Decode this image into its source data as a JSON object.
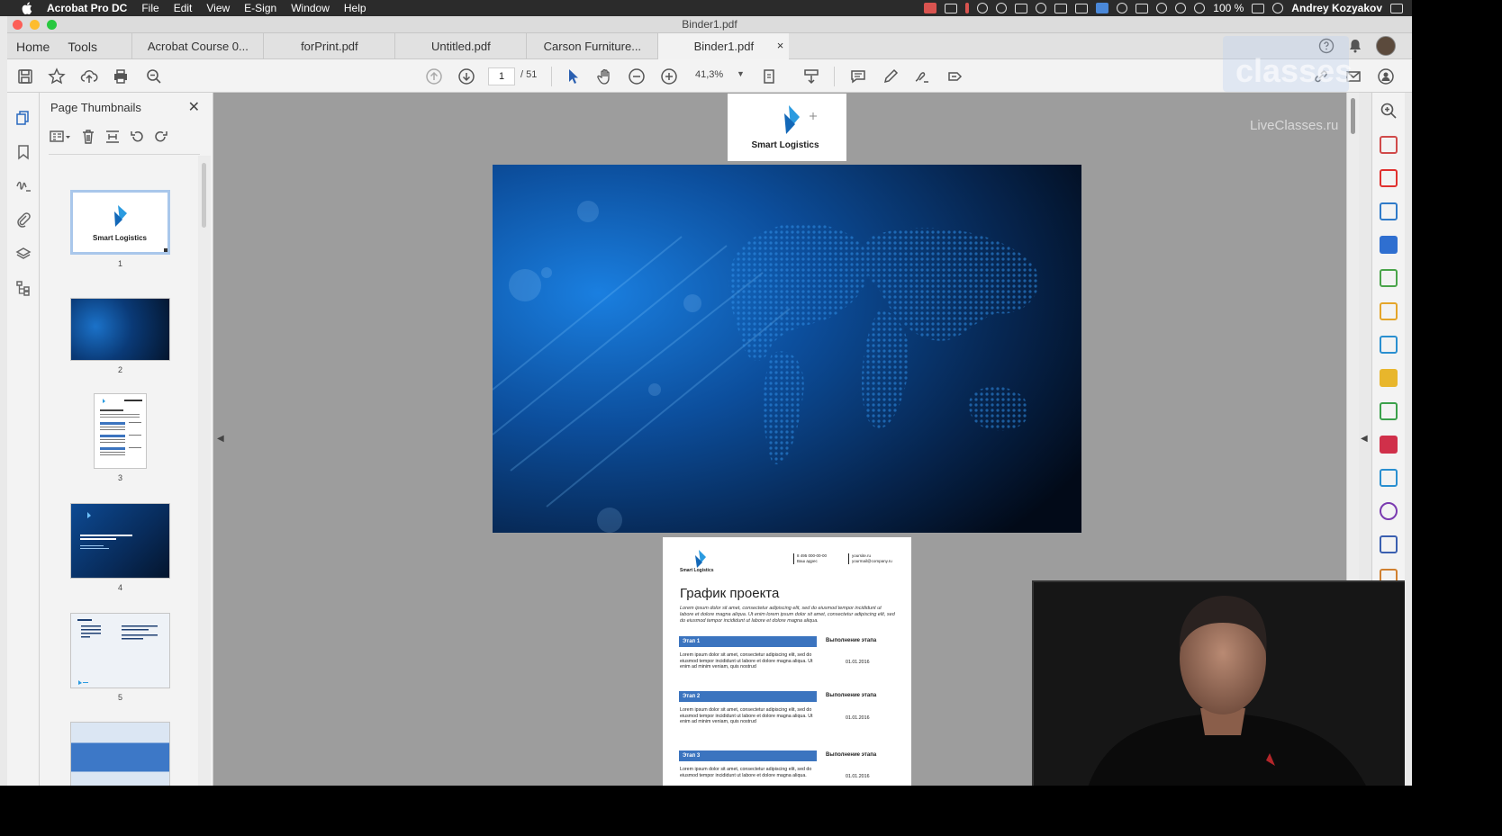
{
  "menubar": {
    "app_name": "Acrobat Pro DC",
    "items": [
      "File",
      "Edit",
      "View",
      "E-Sign",
      "Window",
      "Help"
    ],
    "battery": "100 %",
    "user": "Andrey Kozyakov"
  },
  "window": {
    "title": "Binder1.pdf"
  },
  "tabs": {
    "home": "Home",
    "tools": "Tools",
    "documents": [
      {
        "label": "Acrobat Course 0..."
      },
      {
        "label": "forPrint.pdf"
      },
      {
        "label": "Untitled.pdf"
      },
      {
        "label": "Carson Furniture..."
      },
      {
        "label": "Binder1.pdf",
        "active": true
      }
    ],
    "close_glyph": "×"
  },
  "toolbar": {
    "current_page": "1",
    "total_pages": "/ 51",
    "zoom": "41,3%"
  },
  "thumbnails_panel": {
    "title": "Page Thumbnails",
    "close_glyph": "✕",
    "pages": [
      {
        "number": "1",
        "kind": "logo",
        "selected": true
      },
      {
        "number": "2",
        "kind": "blue"
      },
      {
        "number": "3",
        "kind": "text"
      },
      {
        "number": "4",
        "kind": "blue-title"
      },
      {
        "number": "5",
        "kind": "agenda"
      },
      {
        "number": "",
        "kind": "office"
      }
    ]
  },
  "document": {
    "page1": {
      "logo_text": "Smart Logistics"
    },
    "page3": {
      "logo_text": "Smart Logistics",
      "contacts": [
        {
          "line1": "8 495 000-00-00",
          "line2": "Ваш адрес"
        },
        {
          "line1": "yoursite.ru",
          "line2": "yourmail@company.ru"
        }
      ],
      "title": "График проекта",
      "intro": "Lorem ipsum dolor sit amet, consectetur adipiscing elit, sed do eiusmod tempor incididunt ut labore et dolore magna aliqua. Ut enim lorem ipsum dolor sit amet, consectetur adipiscing elit, sed do eiusmod tempor incididunt ut labore et dolore magna aliqua.",
      "stages": [
        {
          "name": "Этап 1",
          "header": "Выполнение этапа",
          "text": "Lorem ipsum dolor sit amet, consectetur adipiscing elit, sed do eiusmod tempor incididunt ut labore et dolore magna aliqua. Ut enim ad minim veniam, quis nostrud",
          "date": "01.01.2016"
        },
        {
          "name": "Этап 2",
          "header": "Выполнение этапа",
          "text": "Lorem ipsum dolor sit amet, consectetur adipiscing elit, sed do eiusmod tempor incididunt ut labore et dolore magna aliqua. Ut enim ad minim veniam, quis nostrud",
          "date": "01.01.2016"
        },
        {
          "name": "Этап 3",
          "header": "Выполнение этапа",
          "text": "Lorem ipsum dolor sit amet, consectetur adipiscing elit, sed do eiusmod tempor incididunt ut labore et dolore magna aliqua.",
          "date": "01.01.2016"
        }
      ]
    }
  },
  "watermark": {
    "big": "classes",
    "small": "LiveClasses.ru"
  },
  "colors": {
    "accent_blue": "#3b74bf",
    "doc_background": "#9d9d9d",
    "brand_blue": "#1f86d6"
  }
}
